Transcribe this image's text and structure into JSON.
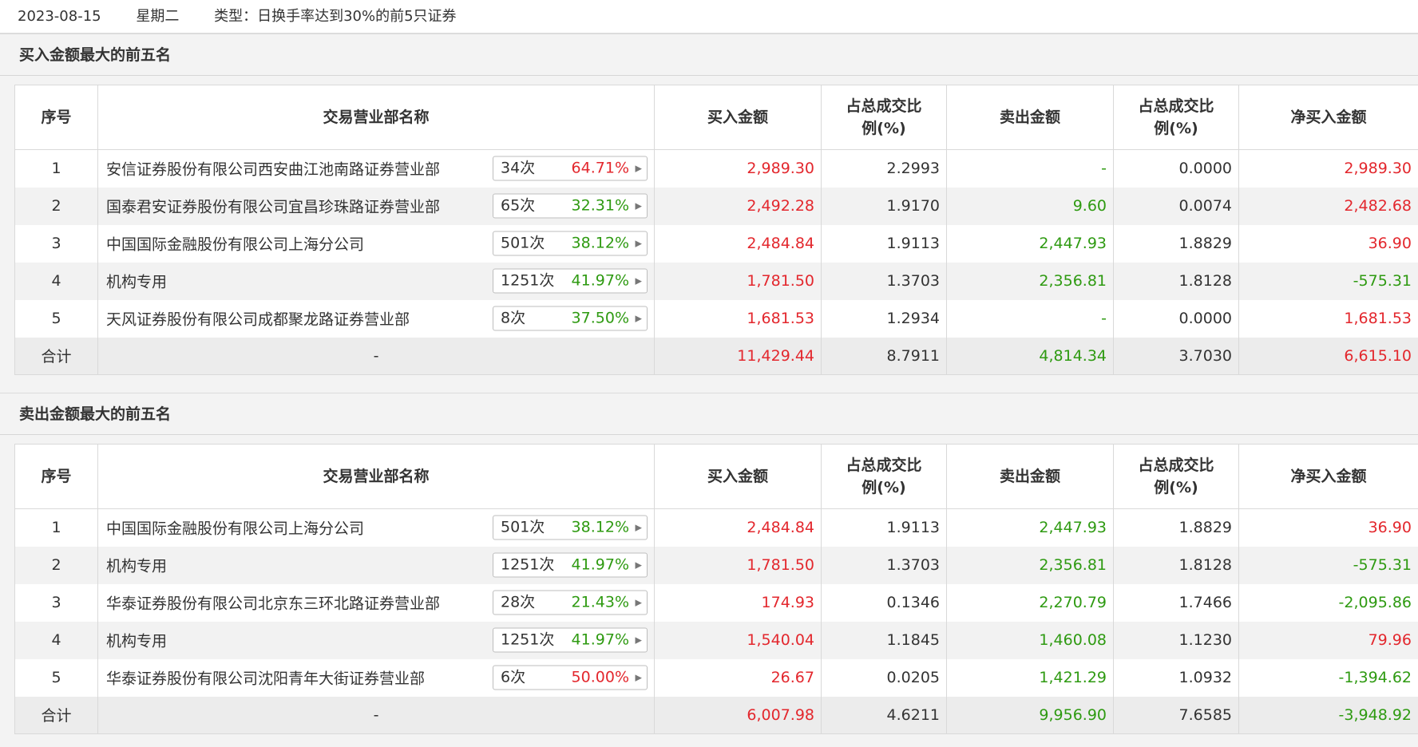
{
  "header": {
    "date": "2023-08-15",
    "weekday": "星期二",
    "type": "类型：日换手率达到30%的前5只证券"
  },
  "columns": [
    "序号",
    "交易营业部名称",
    "买入金额",
    "占总成交比例(%)",
    "卖出金额",
    "占总成交比例(%)",
    "净买入金额"
  ],
  "colors": {
    "up": "#e3272d",
    "down": "#2e9a11"
  },
  "buy_section": {
    "title": "买入金额最大的前五名",
    "rows": [
      {
        "idx": "1",
        "name": "安信证券股份有限公司西安曲江池南路证券营业部",
        "count": "34次",
        "pct": "64.71%",
        "pct_dir": "red",
        "buy": "2,989.30",
        "buy_ratio": "2.2993",
        "sell": "-",
        "sell_ratio": "0.0000",
        "net": "2,989.30",
        "net_dir": "red"
      },
      {
        "idx": "2",
        "name": "国泰君安证券股份有限公司宜昌珍珠路证券营业部",
        "count": "65次",
        "pct": "32.31%",
        "pct_dir": "green",
        "buy": "2,492.28",
        "buy_ratio": "1.9170",
        "sell": "9.60",
        "sell_ratio": "0.0074",
        "net": "2,482.68",
        "net_dir": "red"
      },
      {
        "idx": "3",
        "name": "中国国际金融股份有限公司上海分公司",
        "count": "501次",
        "pct": "38.12%",
        "pct_dir": "green",
        "buy": "2,484.84",
        "buy_ratio": "1.9113",
        "sell": "2,447.93",
        "sell_ratio": "1.8829",
        "net": "36.90",
        "net_dir": "red"
      },
      {
        "idx": "4",
        "name": "机构专用",
        "count": "1251次",
        "pct": "41.97%",
        "pct_dir": "green",
        "buy": "1,781.50",
        "buy_ratio": "1.3703",
        "sell": "2,356.81",
        "sell_ratio": "1.8128",
        "net": "-575.31",
        "net_dir": "green"
      },
      {
        "idx": "5",
        "name": "天风证券股份有限公司成都聚龙路证券营业部",
        "count": "8次",
        "pct": "37.50%",
        "pct_dir": "green",
        "buy": "1,681.53",
        "buy_ratio": "1.2934",
        "sell": "-",
        "sell_ratio": "0.0000",
        "net": "1,681.53",
        "net_dir": "red"
      }
    ],
    "total": {
      "idx": "合计",
      "name": "-",
      "buy": "11,429.44",
      "buy_ratio": "8.7911",
      "sell": "4,814.34",
      "sell_ratio": "3.7030",
      "net": "6,615.10",
      "net_dir": "red"
    }
  },
  "sell_section": {
    "title": "卖出金额最大的前五名",
    "rows": [
      {
        "idx": "1",
        "name": "中国国际金融股份有限公司上海分公司",
        "count": "501次",
        "pct": "38.12%",
        "pct_dir": "green",
        "buy": "2,484.84",
        "buy_ratio": "1.9113",
        "sell": "2,447.93",
        "sell_ratio": "1.8829",
        "net": "36.90",
        "net_dir": "red"
      },
      {
        "idx": "2",
        "name": "机构专用",
        "count": "1251次",
        "pct": "41.97%",
        "pct_dir": "green",
        "buy": "1,781.50",
        "buy_ratio": "1.3703",
        "sell": "2,356.81",
        "sell_ratio": "1.8128",
        "net": "-575.31",
        "net_dir": "green"
      },
      {
        "idx": "3",
        "name": "华泰证券股份有限公司北京东三环北路证券营业部",
        "count": "28次",
        "pct": "21.43%",
        "pct_dir": "green",
        "buy": "174.93",
        "buy_ratio": "0.1346",
        "sell": "2,270.79",
        "sell_ratio": "1.7466",
        "net": "-2,095.86",
        "net_dir": "green"
      },
      {
        "idx": "4",
        "name": "机构专用",
        "count": "1251次",
        "pct": "41.97%",
        "pct_dir": "green",
        "buy": "1,540.04",
        "buy_ratio": "1.1845",
        "sell": "1,460.08",
        "sell_ratio": "1.1230",
        "net": "79.96",
        "net_dir": "red"
      },
      {
        "idx": "5",
        "name": "华泰证券股份有限公司沈阳青年大街证券营业部",
        "count": "6次",
        "pct": "50.00%",
        "pct_dir": "red",
        "buy": "26.67",
        "buy_ratio": "0.0205",
        "sell": "1,421.29",
        "sell_ratio": "1.0932",
        "net": "-1,394.62",
        "net_dir": "green"
      }
    ],
    "total": {
      "idx": "合计",
      "name": "-",
      "buy": "6,007.98",
      "buy_ratio": "4.6211",
      "sell": "9,956.90",
      "sell_ratio": "7.6585",
      "net": "-3,948.92",
      "net_dir": "green"
    }
  }
}
